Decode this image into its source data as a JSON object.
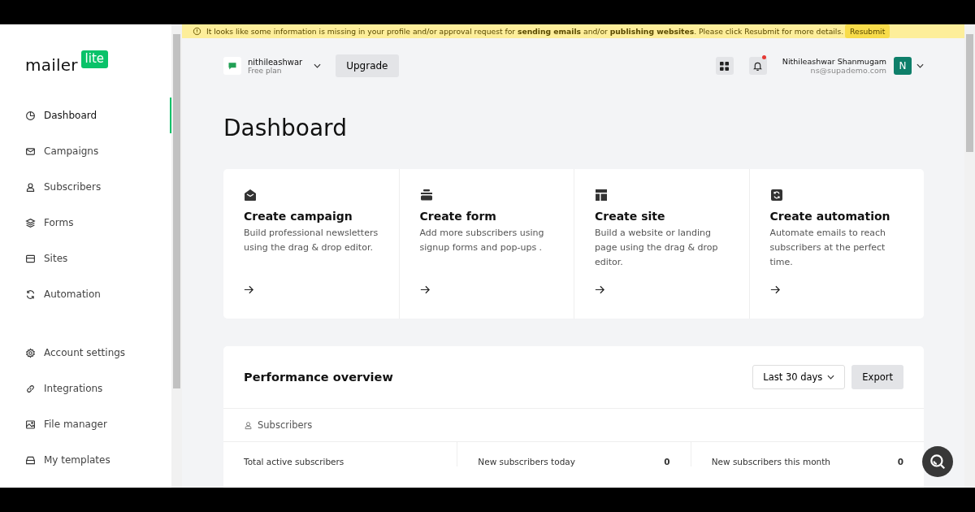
{
  "logo": {
    "word": "mailer",
    "badge": "lite"
  },
  "sidebar": {
    "items": [
      {
        "label": "Dashboard",
        "selected": true
      },
      {
        "label": "Campaigns",
        "selected": false
      },
      {
        "label": "Subscribers",
        "selected": false
      },
      {
        "label": "Forms",
        "selected": false
      },
      {
        "label": "Sites",
        "selected": false
      },
      {
        "label": "Automation",
        "selected": false
      }
    ],
    "bottom_items": [
      {
        "label": "Account settings",
        "selected": false
      },
      {
        "label": "Integrations",
        "selected": false
      },
      {
        "label": "File manager",
        "selected": false
      },
      {
        "label": "My templates",
        "selected": false
      }
    ]
  },
  "alert": {
    "text": "It looks like some information is missing in your profile and/or approval request for **sending emails** and/or **publishing websites**. Please click Resubmit for more details.",
    "button": "Resubmit"
  },
  "account": {
    "name": "nithileashwar",
    "plan": "Free plan",
    "upgrade": "Upgrade"
  },
  "user": {
    "name": "Nithileashwar Shanmugam",
    "email": "ns@supademo.com",
    "initial": "N",
    "notification": true
  },
  "title": "Dashboard",
  "actions": [
    {
      "title": "Create campaign",
      "text": "Build professional newsletters using the drag & drop editor."
    },
    {
      "title": "Create form",
      "text": "Add more subscribers using signup forms and pop-ups ."
    },
    {
      "title": "Create site",
      "text": "Build a website or landing page using the drag & drop editor."
    },
    {
      "title": "Create automation",
      "text": "Automate emails to reach subscribers at the perfect time."
    }
  ],
  "performance": {
    "title": "Performance overview",
    "range": "Last 30 days",
    "export": "Export",
    "tab": "Subscribers",
    "stats": [
      {
        "label": "Total active subscribers"
      },
      {
        "label": "New subscribers today",
        "value": "0"
      },
      {
        "label": "New subscribers this month",
        "value": "0"
      }
    ]
  }
}
